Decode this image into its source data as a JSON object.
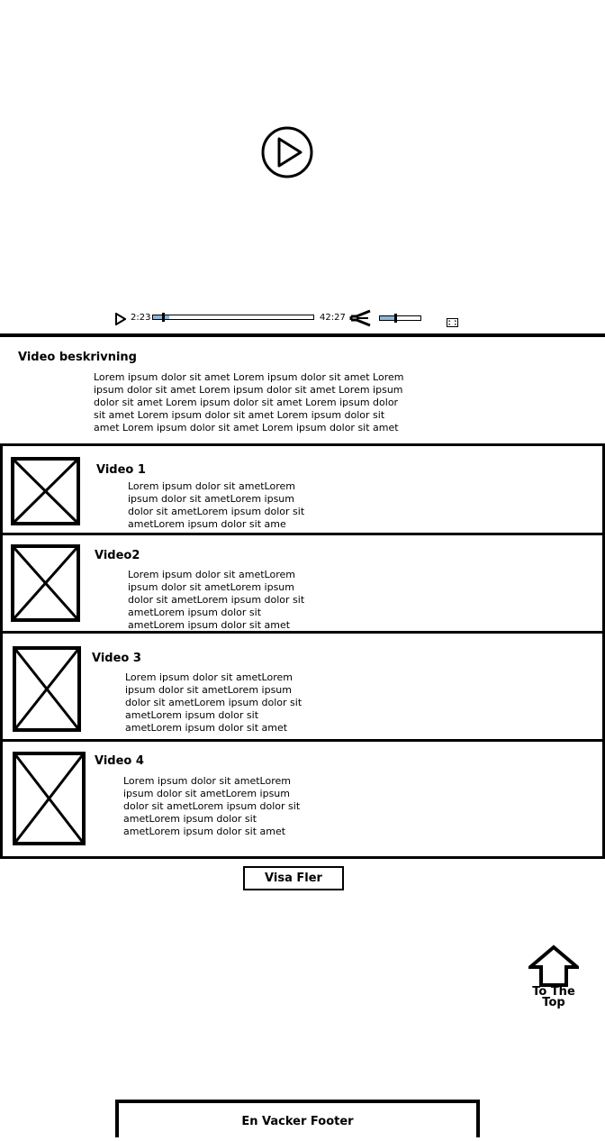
{
  "player": {
    "current_time": "2:23",
    "total_time": "42:27",
    "progress": 0.1,
    "volume": 0.38
  },
  "description": {
    "title": "Video beskrivning",
    "text": "Lorem ipsum dolor sit amet Lorem ipsum dolor sit amet Lorem ipsum dolor sit amet Lorem ipsum dolor sit amet Lorem ipsum dolor sit amet Lorem ipsum dolor sit amet Lorem ipsum dolor sit amet Lorem ipsum dolor sit amet Lorem ipsum dolor sit amet Lorem ipsum dolor sit amet Lorem ipsum dolor sit amet"
  },
  "videos": [
    {
      "title": "Video 1",
      "text": "Lorem ipsum dolor sit ametLorem ipsum dolor sit ametLorem ipsum dolor sit ametLorem ipsum dolor sit ametLorem ipsum dolor sit ame"
    },
    {
      "title": "Video2",
      "text": "Lorem ipsum dolor sit ametLorem ipsum dolor sit ametLorem ipsum dolor sit ametLorem ipsum dolor sit ametLorem ipsum dolor sit ametLorem ipsum dolor sit amet"
    },
    {
      "title": "Video 3",
      "text": "Lorem ipsum dolor sit ametLorem ipsum dolor sit ametLorem ipsum dolor sit ametLorem ipsum dolor sit ametLorem ipsum dolor sit ametLorem ipsum dolor sit amet"
    },
    {
      "title": "Video 4",
      "text": "Lorem ipsum dolor sit ametLorem ipsum dolor sit ametLorem ipsum dolor sit ametLorem ipsum dolor sit ametLorem ipsum dolor sit ametLorem ipsum dolor sit amet"
    }
  ],
  "show_more_label": "Visa Fler",
  "to_top_label": "To The Top",
  "footer_text": "En Vacker Footer",
  "colors": {
    "line": "#000000",
    "accent": "#8fb6d6",
    "background": "#ffffff"
  }
}
